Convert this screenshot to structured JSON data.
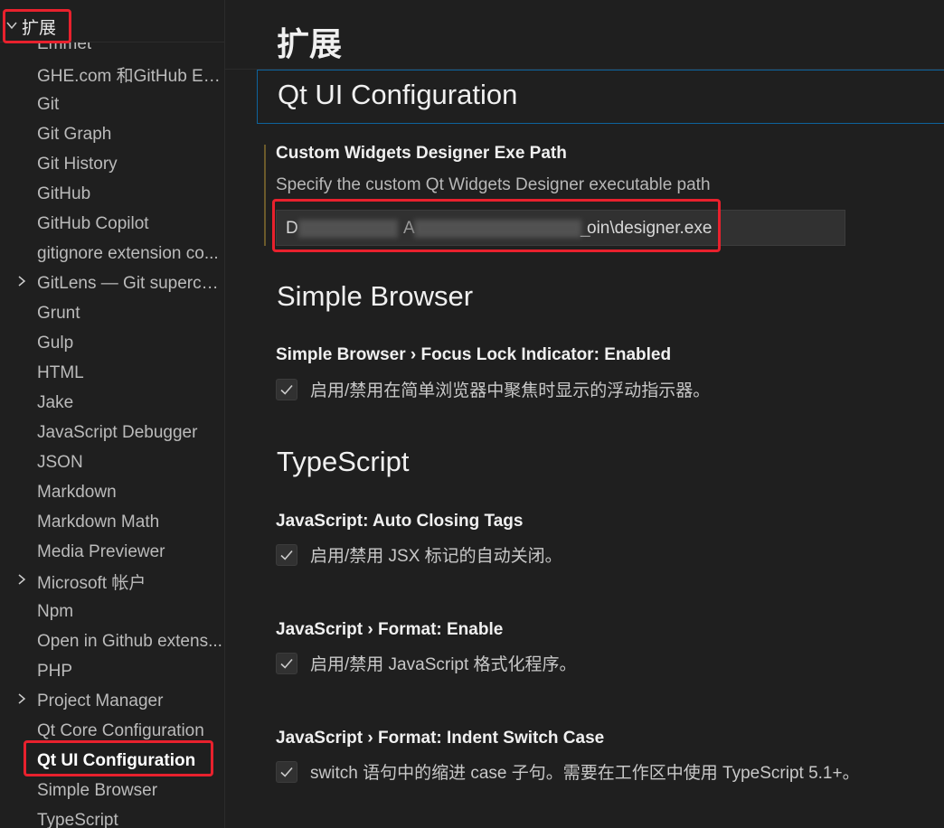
{
  "sidebar": {
    "header": {
      "label": "扩展"
    },
    "items": [
      {
        "label": "Emmet",
        "chevron": false
      },
      {
        "label": "GHE.com 和GitHub En...",
        "chevron": false
      },
      {
        "label": "Git",
        "chevron": false
      },
      {
        "label": "Git Graph",
        "chevron": false
      },
      {
        "label": "Git History",
        "chevron": false
      },
      {
        "label": "GitHub",
        "chevron": false
      },
      {
        "label": "GitHub Copilot",
        "chevron": false
      },
      {
        "label": "gitignore extension co...",
        "chevron": false
      },
      {
        "label": "GitLens — Git superch...",
        "chevron": true
      },
      {
        "label": "Grunt",
        "chevron": false
      },
      {
        "label": "Gulp",
        "chevron": false
      },
      {
        "label": "HTML",
        "chevron": false
      },
      {
        "label": "Jake",
        "chevron": false
      },
      {
        "label": "JavaScript Debugger",
        "chevron": false
      },
      {
        "label": "JSON",
        "chevron": false
      },
      {
        "label": "Markdown",
        "chevron": false
      },
      {
        "label": "Markdown Math",
        "chevron": false
      },
      {
        "label": "Media Previewer",
        "chevron": false
      },
      {
        "label": "Microsoft 帐户",
        "chevron": true
      },
      {
        "label": "Npm",
        "chevron": false
      },
      {
        "label": "Open in Github extens...",
        "chevron": false
      },
      {
        "label": "PHP",
        "chevron": false
      },
      {
        "label": "Project Manager",
        "chevron": true
      },
      {
        "label": "Qt Core Configuration",
        "chevron": false
      },
      {
        "label": "Qt UI Configuration",
        "chevron": false,
        "active": true
      },
      {
        "label": "Simple Browser",
        "chevron": false
      },
      {
        "label": "TypeScript",
        "chevron": false
      }
    ]
  },
  "main": {
    "page_title": "扩展",
    "section_header": "Qt UI Configuration",
    "designer_setting": {
      "title": "Custom Widgets Designer Exe Path",
      "description": "Specify the custom Qt Widgets Designer executable path",
      "value_visible_prefix": "D",
      "value_visible_suffix": "oin\\designer.exe",
      "value_visible_mid": "A",
      "value_visible_mid2": "_"
    },
    "simple_browser": {
      "group_title": "Simple Browser",
      "setting_category": "Simple Browser › Focus Lock Indicator: ",
      "setting_key": "Enabled",
      "checkbox_label": "启用/禁用在简单浏览器中聚焦时显示的浮动指示器。",
      "checked": true
    },
    "typescript": {
      "group_title": "TypeScript",
      "settings": [
        {
          "category": "JavaScript: ",
          "key": "Auto Closing Tags",
          "label": "启用/禁用 JSX 标记的自动关闭。",
          "checked": true
        },
        {
          "category": "JavaScript › Format: ",
          "key": "Enable",
          "label": "启用/禁用 JavaScript 格式化程序。",
          "checked": true
        },
        {
          "category": "JavaScript › Format: ",
          "key": "Indent Switch Case",
          "label": "switch 语句中的缩进 case 子句。需要在工作区中使用 TypeScript 5.1+。",
          "checked": true
        }
      ]
    }
  },
  "colors": {
    "background": "#1f1f1f",
    "highlight_box": "#e8212d",
    "focus_border": "#0e639c",
    "modified_indicator": "#6b5a2a"
  }
}
